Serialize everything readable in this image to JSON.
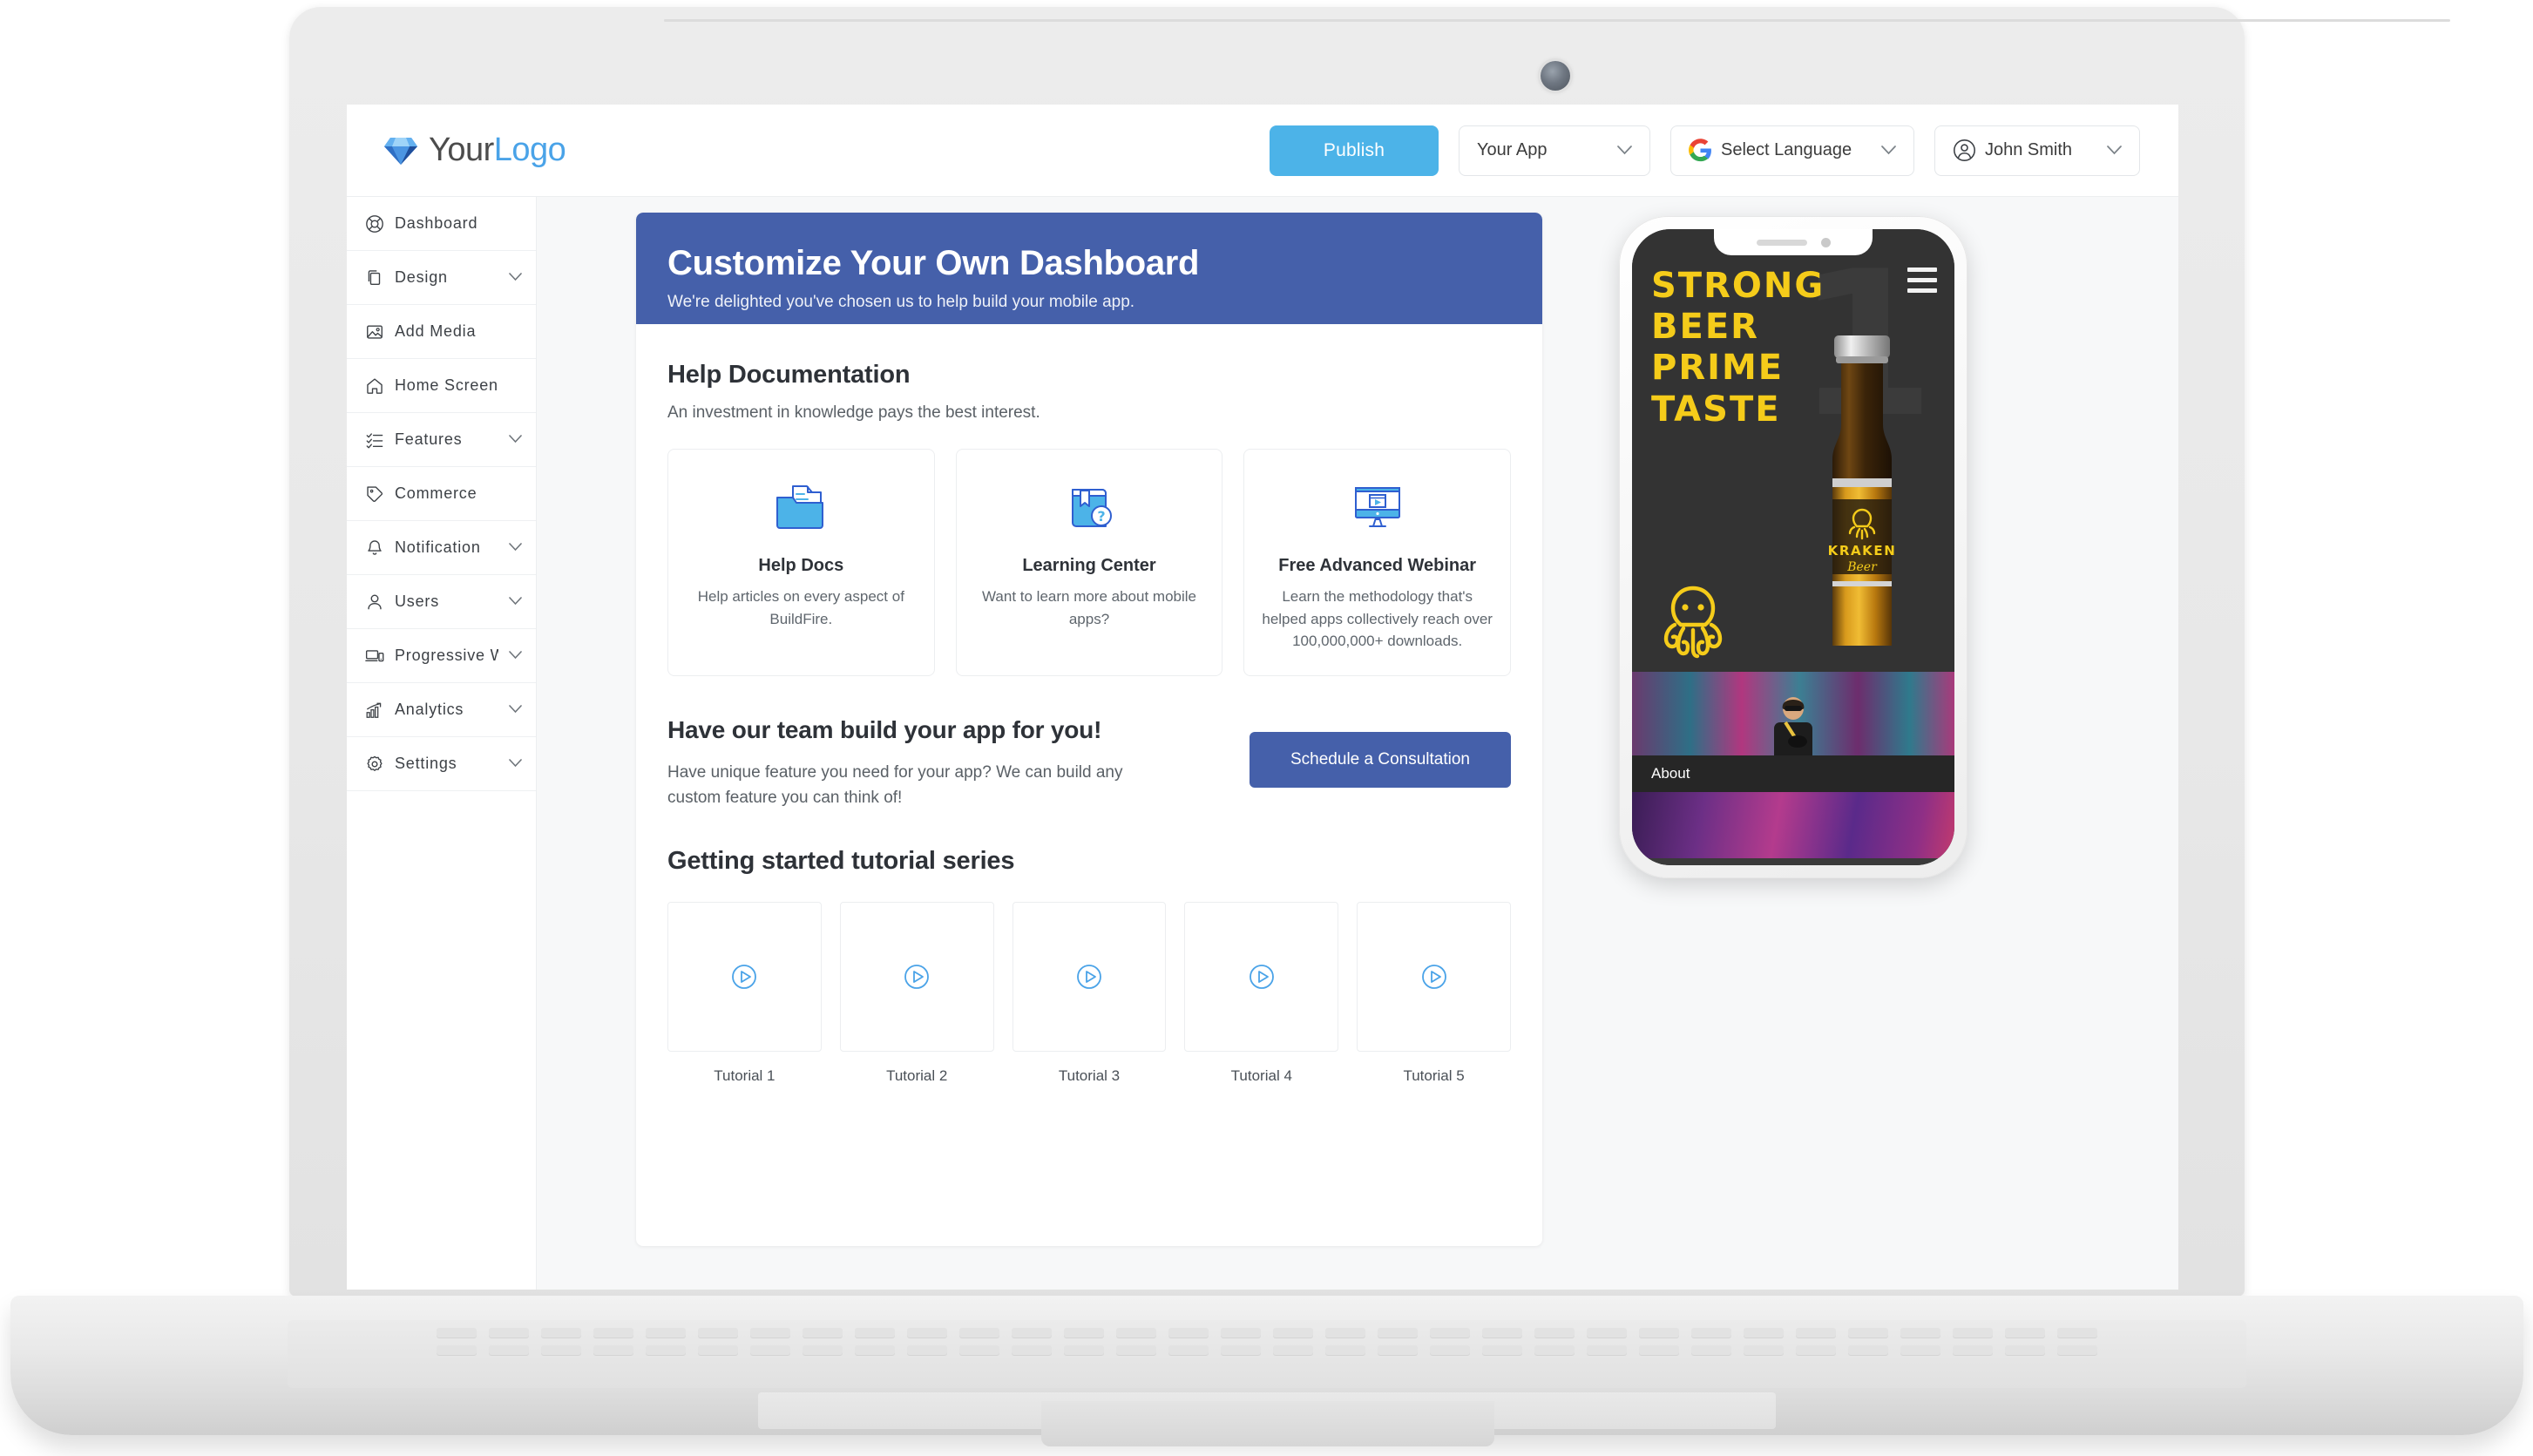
{
  "brand": {
    "part1": "Your",
    "part2": "Logo",
    "icon": "diamond-icon"
  },
  "header": {
    "publish_label": "Publish",
    "app_selector_value": "Your App",
    "language_selector_value": "Select Language",
    "language_icon": "google-g-icon",
    "user_name": "John Smith",
    "user_icon": "user-circle-icon",
    "caret_glyph": "⌄"
  },
  "sidebar": {
    "items": [
      {
        "label": "Dashboard",
        "icon": "lifebuoy-icon",
        "expandable": false
      },
      {
        "label": "Design",
        "icon": "layers-icon",
        "expandable": true
      },
      {
        "label": "Add Media",
        "icon": "image-icon",
        "expandable": false
      },
      {
        "label": "Home Screen",
        "icon": "home-icon",
        "expandable": false
      },
      {
        "label": "Features",
        "icon": "checklist-icon",
        "expandable": true
      },
      {
        "label": "Commerce",
        "icon": "tag-icon",
        "expandable": false
      },
      {
        "label": "Notification",
        "icon": "bell-icon",
        "expandable": true
      },
      {
        "label": "Users",
        "icon": "user-icon",
        "expandable": true
      },
      {
        "label": "Progressive W...",
        "icon": "devices-icon",
        "expandable": true
      },
      {
        "label": "Analytics",
        "icon": "bar-chart-icon",
        "expandable": true
      },
      {
        "label": "Settings",
        "icon": "gear-icon",
        "expandable": true
      }
    ]
  },
  "banner": {
    "title": "Customize Your Own Dashboard",
    "subtitle": "We're delighted you've chosen us to help build your mobile app.",
    "color": "#4560aa"
  },
  "help_section": {
    "title": "Help Documentation",
    "subtitle": "An investment in knowledge pays the best interest.",
    "cards": [
      {
        "title": "Help Docs",
        "desc": "Help articles on every aspect of BuildFire.",
        "icon": "folder-document-icon"
      },
      {
        "title": "Learning Center",
        "desc": "Want to learn more about mobile apps?",
        "icon": "book-question-icon"
      },
      {
        "title": "Free Advanced Webinar",
        "desc": "Learn the methodology that's helped apps collectively reach over 100,000,000+ downloads.",
        "icon": "monitor-video-icon"
      }
    ]
  },
  "team_section": {
    "title": "Have our team build your app for you!",
    "desc": "Have unique feature you need for your app? We can build any custom feature you can think of!",
    "cta_label": "Schedule a Consultation",
    "cta_color": "#4560aa"
  },
  "tutorials_section": {
    "title": "Getting started tutorial series",
    "items": [
      {
        "label": "Tutorial 1",
        "icon": "play-circle-icon"
      },
      {
        "label": "Tutorial 2",
        "icon": "play-circle-icon"
      },
      {
        "label": "Tutorial 3",
        "icon": "play-circle-icon"
      },
      {
        "label": "Tutorial 4",
        "icon": "play-circle-icon"
      },
      {
        "label": "Tutorial 5",
        "icon": "play-circle-icon"
      }
    ]
  },
  "phone_preview": {
    "hero_line1": "STRONG",
    "hero_line2": "BEER",
    "hero_line3": "PRIME",
    "hero_line4": "TASTE",
    "ghost_number": "1",
    "brand_name": "KRAKEN",
    "brand_sub": "Beer",
    "about_label": "About",
    "menu_icon": "hamburger-menu-icon",
    "accent_color": "#f5cc1a",
    "background_color": "#333333",
    "tabs": [
      {
        "icon": "beer-mug-icon"
      },
      {
        "icon": "home-icon"
      },
      {
        "icon": "phone-call-icon"
      }
    ]
  },
  "theme": {
    "publish_blue": "#4cb3e8",
    "banner_blue": "#4560aa",
    "page_bg": "#f7f8f9"
  }
}
